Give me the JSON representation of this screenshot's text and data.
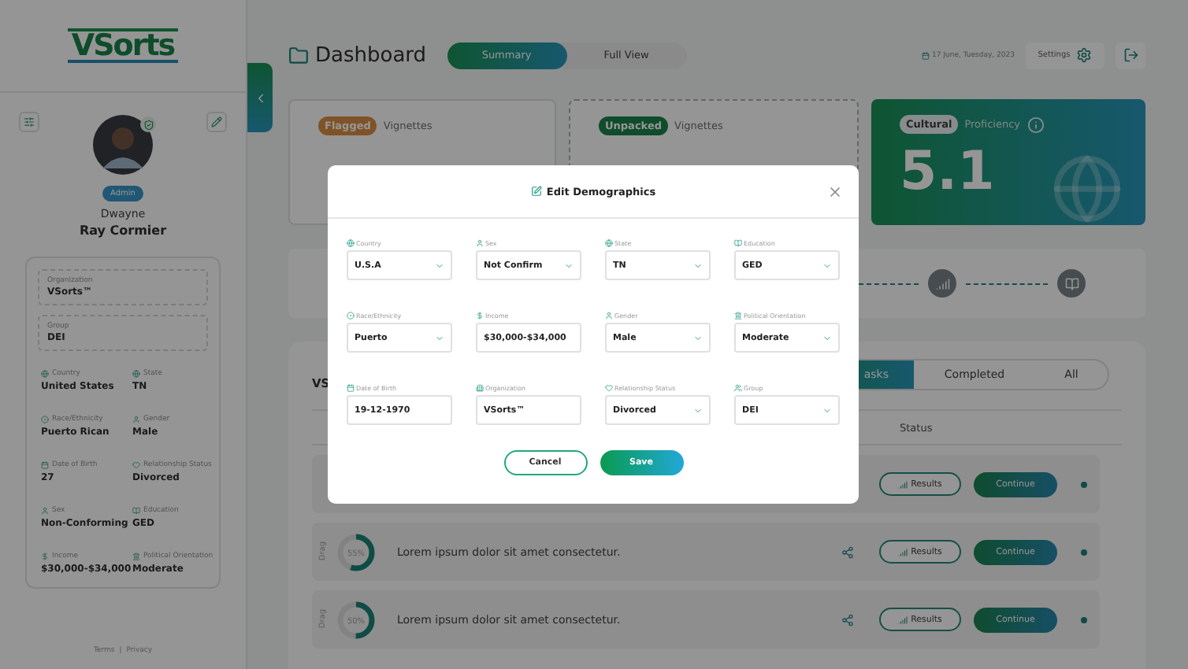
{
  "sidebar": {
    "logo": "VSorts",
    "role": "Admin",
    "first_name": "Dwayne",
    "last_name": "Ray Cormier",
    "org_boxes": [
      {
        "label": "Organization",
        "value": "VSorts™"
      },
      {
        "label": "Group",
        "value": "DEI"
      }
    ],
    "details": [
      {
        "label": "Country",
        "value": "United States"
      },
      {
        "label": "State",
        "value": "TN"
      },
      {
        "label": "Race/Ethnicity",
        "value": "Puerto Rican"
      },
      {
        "label": "Gender",
        "value": "Male"
      },
      {
        "label": "Date of Birth",
        "value": "27"
      },
      {
        "label": "Relationship Status",
        "value": "Divorced"
      },
      {
        "label": "Sex",
        "value": "Non-Conforming"
      },
      {
        "label": "Education",
        "value": "GED"
      },
      {
        "label": "Income",
        "value": "$30,000-$34,000"
      },
      {
        "label": "Political Orientation",
        "value": "Moderate"
      }
    ],
    "footer": [
      "Terms",
      "|",
      "Privacy"
    ]
  },
  "header": {
    "title": "Dashboard",
    "views": [
      {
        "label": "Summary",
        "selected": true
      },
      {
        "label": "Full View",
        "selected": false
      }
    ],
    "date": "17 June, Tuesday, 2023",
    "settings": "Settings"
  },
  "cards": [
    {
      "kind": "flagged",
      "tag": "Flagged",
      "label": "Vignettes"
    },
    {
      "kind": "unpacked",
      "tag": "Unpacked",
      "label": "Vignettes"
    },
    {
      "kind": "cultural",
      "tag": "Cultural",
      "label": "Proficiency",
      "value": "5.1"
    }
  ],
  "tasks": {
    "heading": "VS",
    "tabs": [
      {
        "label": "asks",
        "selected": true
      },
      {
        "label": "Completed",
        "selected": false
      },
      {
        "label": "All",
        "selected": false
      }
    ],
    "status_column": "Status",
    "rows": [
      {
        "results": "Results",
        "continue": "Continue"
      },
      {
        "drag": "Drag",
        "percent": "55%",
        "text": "Lorem ipsum dolor sit amet consectetur.",
        "results": "Results",
        "continue": "Continue"
      },
      {
        "drag": "Drag",
        "percent": "50%",
        "text": "Lorem ipsum dolor sit amet consectetur.",
        "results": "Results",
        "continue": "Continue"
      }
    ]
  },
  "modal": {
    "title": "Edit Demographics",
    "fields": [
      {
        "label": "Country",
        "value": "U.S.A",
        "kind": "select"
      },
      {
        "label": "Sex",
        "value": "Not Confirm",
        "kind": "select"
      },
      {
        "label": "State",
        "value": "TN",
        "kind": "select"
      },
      {
        "label": "Education",
        "value": "GED",
        "kind": "select"
      },
      {
        "label": "Race/Ethnicity",
        "value": "Puerto",
        "kind": "select"
      },
      {
        "label": "Income",
        "value": "$30,000-$34,000",
        "kind": "input"
      },
      {
        "label": "Gender",
        "value": "Male",
        "kind": "select"
      },
      {
        "label": "Political Orientation",
        "value": "Moderate",
        "kind": "select"
      },
      {
        "label": "Date of Birth",
        "value": "19-12-1970",
        "kind": "input"
      },
      {
        "label": "Organization",
        "value": "VSorts™",
        "kind": "input"
      },
      {
        "label": "Relationship Status",
        "value": "Divorced",
        "kind": "select"
      },
      {
        "label": "Group",
        "value": "DEI",
        "kind": "select"
      }
    ],
    "cancel": "Cancel",
    "save": "Save"
  }
}
